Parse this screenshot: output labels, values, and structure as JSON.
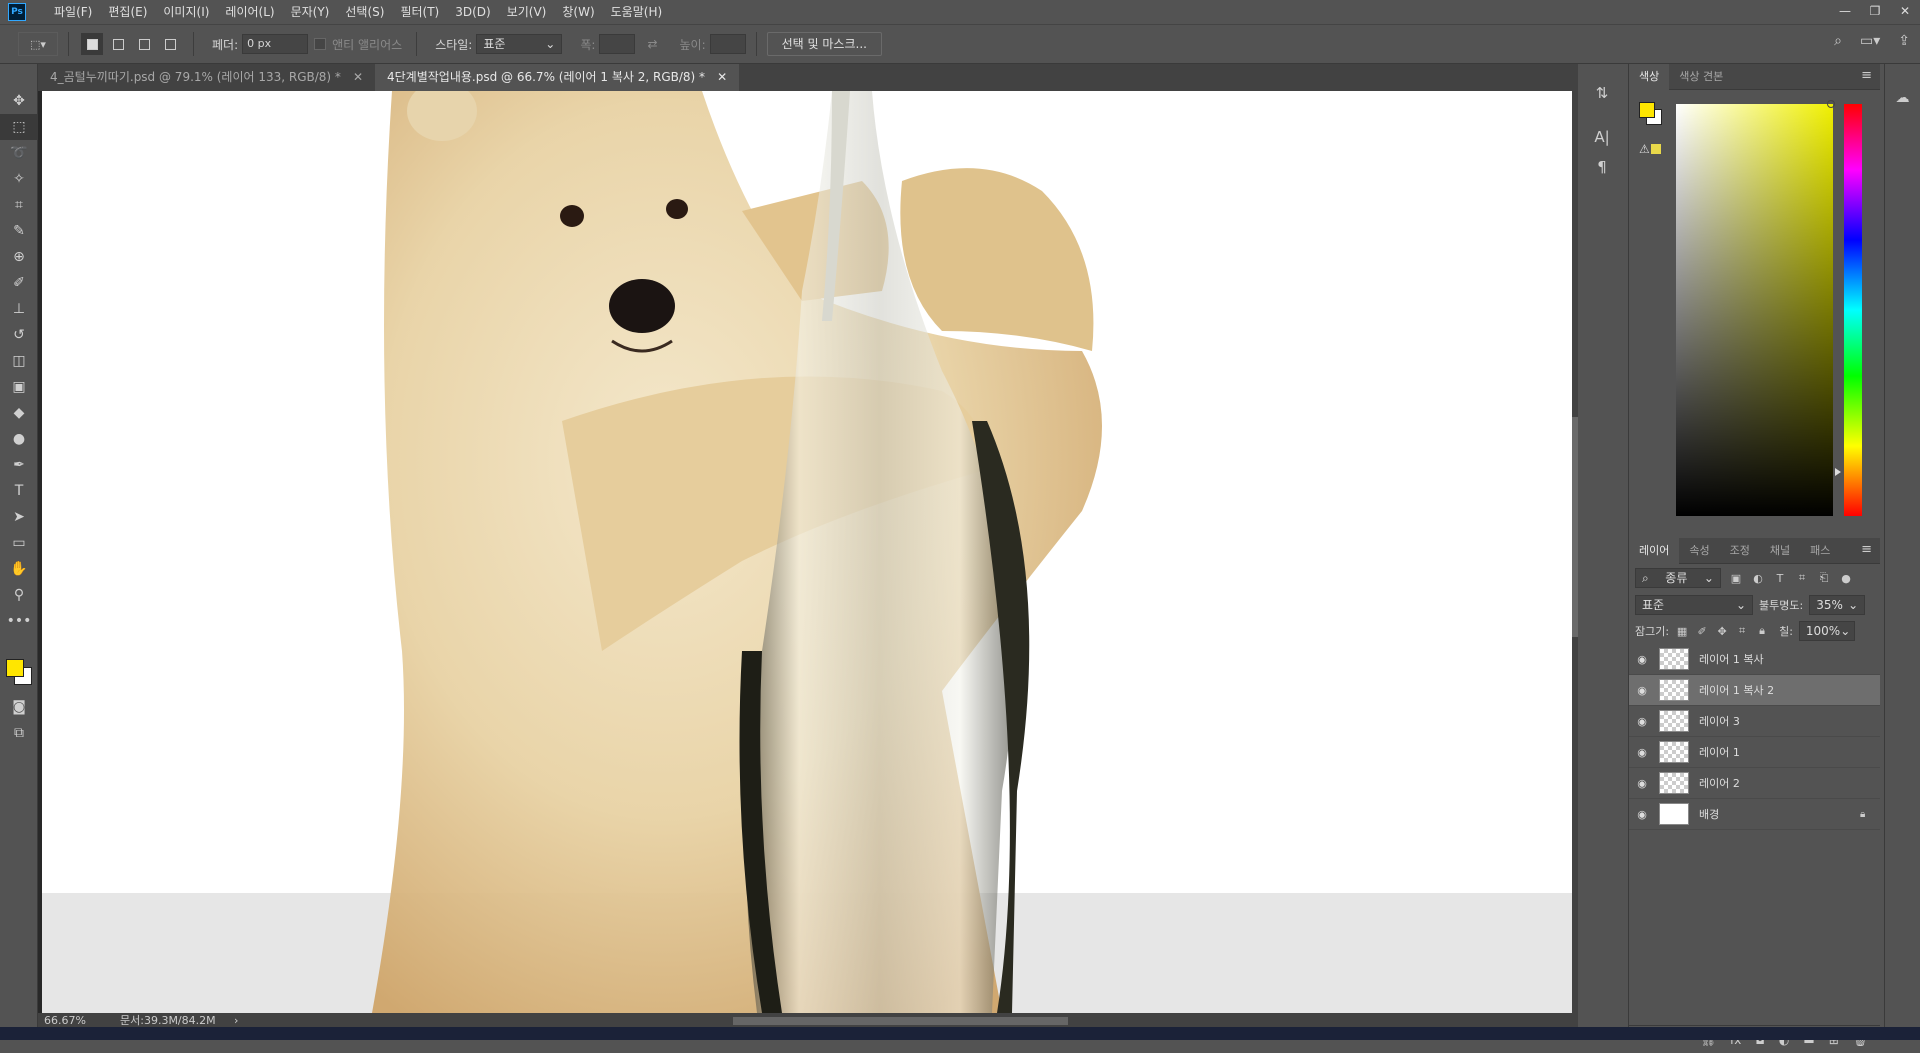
{
  "app": {
    "logo": "Ps",
    "window_controls": [
      "—",
      "❐",
      "✕"
    ]
  },
  "menu": [
    "파일(F)",
    "편집(E)",
    "이미지(I)",
    "레이어(L)",
    "문자(Y)",
    "선택(S)",
    "필터(T)",
    "3D(D)",
    "보기(V)",
    "창(W)",
    "도움말(H)"
  ],
  "options": {
    "feather_label": "페더:",
    "feather_value": "0 px",
    "antialias_label": "앤티 앨리어스",
    "style_label": "스타일:",
    "style_value": "표준",
    "width_label": "폭:",
    "height_label": "높이:",
    "select_mask_button": "선택 및 마스크..."
  },
  "tabs": [
    {
      "label": "4_곰털누끼따기.psd @ 79.1% (레이어 133, RGB/8) *",
      "close": "✕"
    },
    {
      "label": "4단계별작업내용.psd @ 66.7% (레이어 1 복사 2, RGB/8) *",
      "close": "✕"
    }
  ],
  "status": {
    "zoom": "66.67%",
    "doc": "문서:39.3M/84.2M",
    "arrow": "›"
  },
  "color_panel": {
    "tabs": [
      "색상",
      "색상 견본"
    ],
    "fg": "#ffe600",
    "bg": "#ffffff"
  },
  "layer_panel": {
    "tabs": [
      "레이어",
      "속성",
      "조정",
      "채널",
      "패스"
    ],
    "filter_label": "종류",
    "blend_mode": "표준",
    "opacity_label": "불투명도:",
    "opacity_value": "35%",
    "lock_label": "잠그기:",
    "fill_label": "칠:",
    "fill_value": "100%",
    "layers": [
      "레이어 1 복사",
      "레이어 1 복사 2",
      "레이어 3",
      "레이어 1",
      "레이어 2",
      "배경"
    ],
    "footer_icons": [
      "link-icon",
      "fx-icon",
      "mask-icon",
      "adjustment-icon",
      "folder-icon",
      "new-layer-icon",
      "trash-icon"
    ]
  }
}
